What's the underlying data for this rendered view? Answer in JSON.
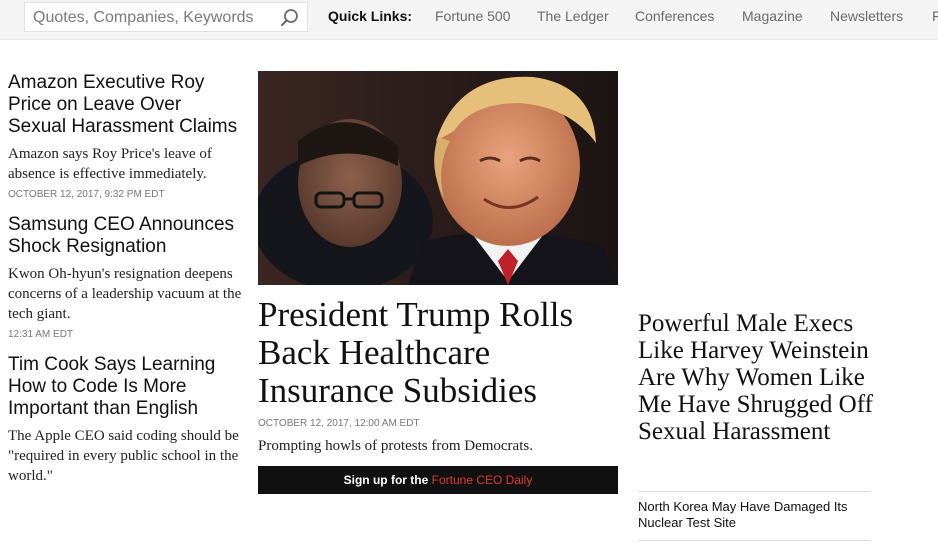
{
  "search": {
    "placeholder": "Quotes, Companies, Keywords"
  },
  "quick_links": {
    "label": "Quick Links:",
    "items": [
      "Fortune 500",
      "The Ledger",
      "Conferences",
      "Magazine",
      "Newsletters",
      "F"
    ]
  },
  "left_stories": [
    {
      "headline": "Amazon Executive Roy Price on Leave Over Sexual Harassment Claims",
      "dek": "Amazon says Roy Price's leave of absence is effective immediately.",
      "timestamp": "OCTOBER 12, 2017, 9:32 PM EDT"
    },
    {
      "headline": "Samsung CEO Announces Shock Resignation",
      "dek": "Kwon Oh-hyun's resignation deepens concerns of a leadership vacuum at the tech giant.",
      "timestamp": "12:31 AM EDT"
    },
    {
      "headline": "Tim Cook Says Learning How to Code Is More Important than English",
      "dek": "The Apple CEO said coding should be \"required in every public school in the world.\""
    }
  ],
  "main_story": {
    "headline": "President Trump Rolls Back Healthcare Insurance Subsidies",
    "timestamp": "OCTOBER 12, 2017, 12:00 AM EDT",
    "dek": "Prompting howls of protests from Democrats."
  },
  "signup": {
    "prefix": "Sign up for the ",
    "brand": "Fortune CEO Daily"
  },
  "right_stories": {
    "headline": "Powerful Male Execs Like Harvey Weinstein Are Why Women Like Me Have Shrugged Off Sexual Harassment",
    "small": "North Korea May Have Damaged Its Nuclear Test Site"
  },
  "colors": {
    "accent": "#e03a2e",
    "topbar_bg": "#f4f4f4",
    "signup_bg": "#111111"
  },
  "icons": {
    "search": "magnifier"
  }
}
